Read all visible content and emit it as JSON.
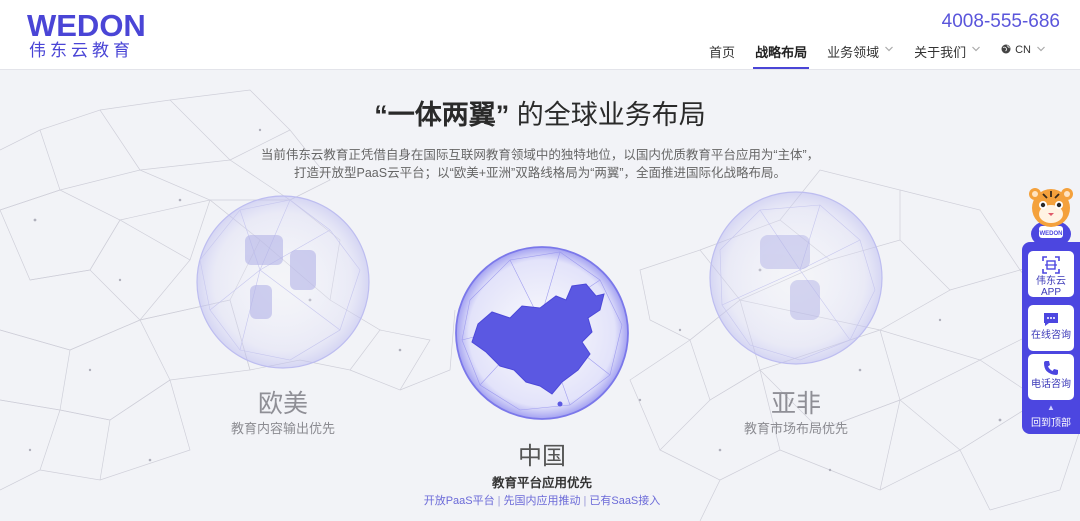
{
  "header": {
    "logo_word": "WEDON",
    "logo_sub": "伟东云教育",
    "phone": "4008-555-686",
    "nav": [
      {
        "label": "首页"
      },
      {
        "label": "战略布局"
      },
      {
        "label": "业务领域"
      },
      {
        "label": "关于我们"
      }
    ],
    "lang": "CN"
  },
  "hero": {
    "title_quote": "“一体两翼”",
    "title_rest": " 的全球业务布局",
    "desc_line1": "当前伟东云教育正凭借自身在国际互联网教育领域中的独特地位，以国内优质教育平台应用为“主体”，",
    "desc_line2": "打造开放型PaaS云平台；以“欧美+亚洲”双路线格局为“两翼”，全面推进国际化战略布局。"
  },
  "regions": {
    "west": {
      "name": "欧美",
      "sub": "教育内容输出优先"
    },
    "east": {
      "name": "亚非",
      "sub": "教育市场布局优先"
    },
    "china": {
      "name": "中国",
      "sub": "教育平台应用优先",
      "links": [
        "开放PaaS平台",
        "先国内应用推动",
        "已有SaaS接入"
      ],
      "separator": "|"
    }
  },
  "side": {
    "app_label": "伟东云APP",
    "chat_label": "在线咨询",
    "phone_label": "电话咨询",
    "top_label": "回到顶部",
    "mascot_badge": "WEDON"
  },
  "colors": {
    "brand": "#4a45d6",
    "side_bg": "#4c46e0",
    "link": "#6b6ad8"
  }
}
